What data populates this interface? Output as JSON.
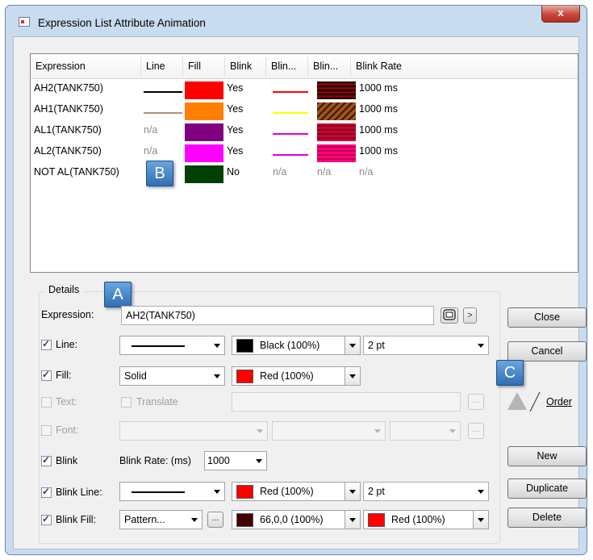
{
  "window": {
    "title": "Expression List Attribute Animation",
    "close_glyph": "x"
  },
  "list": {
    "headers": [
      "Expression",
      "Line",
      "Fill",
      "Blink",
      "Blin...",
      "Blin...",
      "Blink Rate"
    ],
    "rows": [
      {
        "expression": "AH2(TANK750)",
        "line": {
          "color": "#000000"
        },
        "fill": "#ff0000",
        "blink": "Yes",
        "blink_line": {
          "color": "#ff0000"
        },
        "blink_fill": {
          "color": "#660000",
          "pattern": "horizontal"
        },
        "blink_rate": "1000 ms"
      },
      {
        "expression": "AH1(TANK750)",
        "line": {
          "color": "#b08c80"
        },
        "fill": "#ff8000",
        "blink": "Yes",
        "blink_line": {
          "color": "#ffff00"
        },
        "blink_fill": {
          "color": "#8b4513",
          "pattern": "diagonal"
        },
        "blink_rate": "1000 ms"
      },
      {
        "expression": "AL1(TANK750)",
        "line": {
          "text": "n/a"
        },
        "fill": "#800080",
        "blink": "Yes",
        "blink_line": {
          "color": "#e000e0"
        },
        "blink_fill": {
          "color": "#cc0033",
          "pattern": "horizontal"
        },
        "blink_rate": "1000 ms"
      },
      {
        "expression": "AL2(TANK750)",
        "line": {
          "text": "n/a"
        },
        "fill": "#ff00ff",
        "blink": "Yes",
        "blink_line": {
          "color": "#e000e0"
        },
        "blink_fill": {
          "color": "#ff0080",
          "pattern": "horizontal"
        },
        "blink_rate": "1000 ms"
      },
      {
        "expression": "NOT AL(TANK750)",
        "line": {
          "text": ""
        },
        "fill": "#004000",
        "blink": "No",
        "blink_line": {
          "text": "n/a"
        },
        "blink_fill": {
          "text": "n/a"
        },
        "blink_rate": "n/a"
      }
    ]
  },
  "callouts": {
    "a": "A",
    "b": "B",
    "c": "C"
  },
  "details": {
    "group_label": "Details",
    "expression": {
      "label": "Expression:",
      "value": "AH2(TANK750)"
    },
    "line": {
      "label": "Line:",
      "checked": true,
      "color_text": "Black (100%)",
      "color": "#000000",
      "width": "2 pt"
    },
    "fill": {
      "label": "Fill:",
      "checked": true,
      "style": "Solid",
      "color_text": "Red (100%)",
      "color": "#ff0000"
    },
    "text": {
      "label": "Text:",
      "checked": false,
      "translate_label": "Translate"
    },
    "font": {
      "label": "Font:",
      "checked": false
    },
    "blink": {
      "label": "Blink",
      "checked": true,
      "rate_label": "Blink Rate: (ms)",
      "rate_value": "1000"
    },
    "blink_line": {
      "label": "Blink Line:",
      "checked": true,
      "color_text": "Red (100%)",
      "color": "#ff0000",
      "width": "2 pt"
    },
    "blink_fill": {
      "label": "Blink Fill:",
      "checked": true,
      "style": "Pattern...",
      "color_text": "66,0,0 (100%)",
      "color": "#420000",
      "color2_text": "Red (100%)",
      "color2": "#ff0000"
    },
    "ellipsis": "..."
  },
  "buttons": {
    "close": "Close",
    "cancel": "Cancel",
    "order": "Order",
    "new": "New",
    "duplicate": "Duplicate",
    "delete": "Delete"
  },
  "expression_browse_glyph": ">"
}
